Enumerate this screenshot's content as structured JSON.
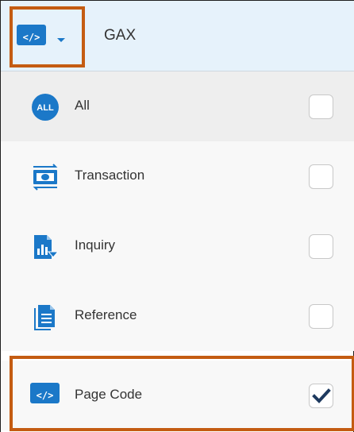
{
  "header": {
    "title": "GAX",
    "type_icon": "code-icon",
    "type_icon_text": "</>",
    "dropdown_icon": "chevron-down-icon"
  },
  "menu": {
    "items": [
      {
        "label": "All",
        "icon": "all-icon",
        "icon_text": "ALL",
        "checked": false
      },
      {
        "label": "Transaction",
        "icon": "transaction-icon",
        "checked": false
      },
      {
        "label": "Inquiry",
        "icon": "inquiry-icon",
        "checked": false
      },
      {
        "label": "Reference",
        "icon": "reference-icon",
        "checked": false
      },
      {
        "label": "Page Code",
        "icon": "page-code-icon",
        "icon_text": "</>",
        "checked": true
      }
    ]
  },
  "colors": {
    "accent": "#1b78c8",
    "highlight": "#c45c12",
    "header_bg": "#e6f2fb"
  }
}
